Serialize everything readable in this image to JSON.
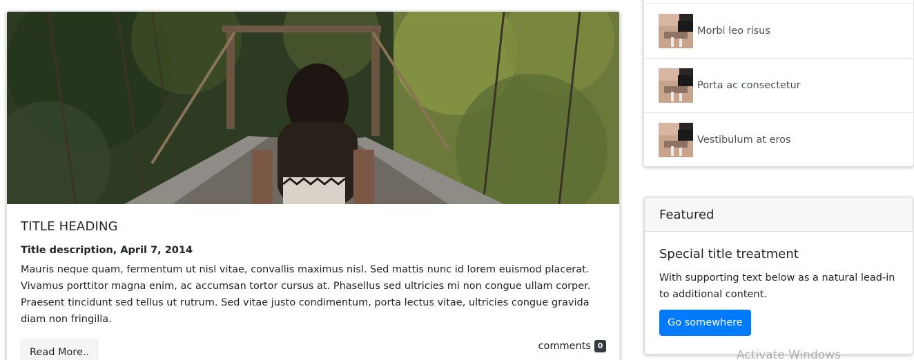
{
  "main_card": {
    "hero_image": "person-on-suspension-bridge-photo",
    "title": "TITLE HEADING",
    "description": "Title description, April 7, 2014",
    "body": "Mauris neque quam, fermentum ut nisl vitae, convallis maximus nisl. Sed mattis nunc id lorem euismod placerat. Vivamus porttitor magna enim, ac accumsan tortor cursus at. Phasellus sed ultricies mi non congue ullam corper. Praesent tincidunt sed tellus ut rutrum. Sed vitae justo condimentum, porta lectus vitae, ultricies congue gravida diam non fringilla.",
    "read_more_label": "Read More..",
    "comments_label": "comments",
    "comments_count": "0"
  },
  "sidebar_list": {
    "items": [
      {
        "label": "Morbi leo risus",
        "thumb": "desk-photo-thumbnail"
      },
      {
        "label": "Porta ac consectetur",
        "thumb": "desk-photo-thumbnail"
      },
      {
        "label": "Vestibulum at eros",
        "thumb": "desk-photo-thumbnail"
      }
    ]
  },
  "featured": {
    "header": "Featured",
    "title": "Special title treatment",
    "text": "With supporting text below as a natural lead-in to additional content.",
    "button_label": "Go somewhere"
  },
  "watermark": "Activate Windows",
  "colors": {
    "primary": "#007bff",
    "badge": "#343a40",
    "text": "#212529",
    "muted_text": "#495057"
  }
}
